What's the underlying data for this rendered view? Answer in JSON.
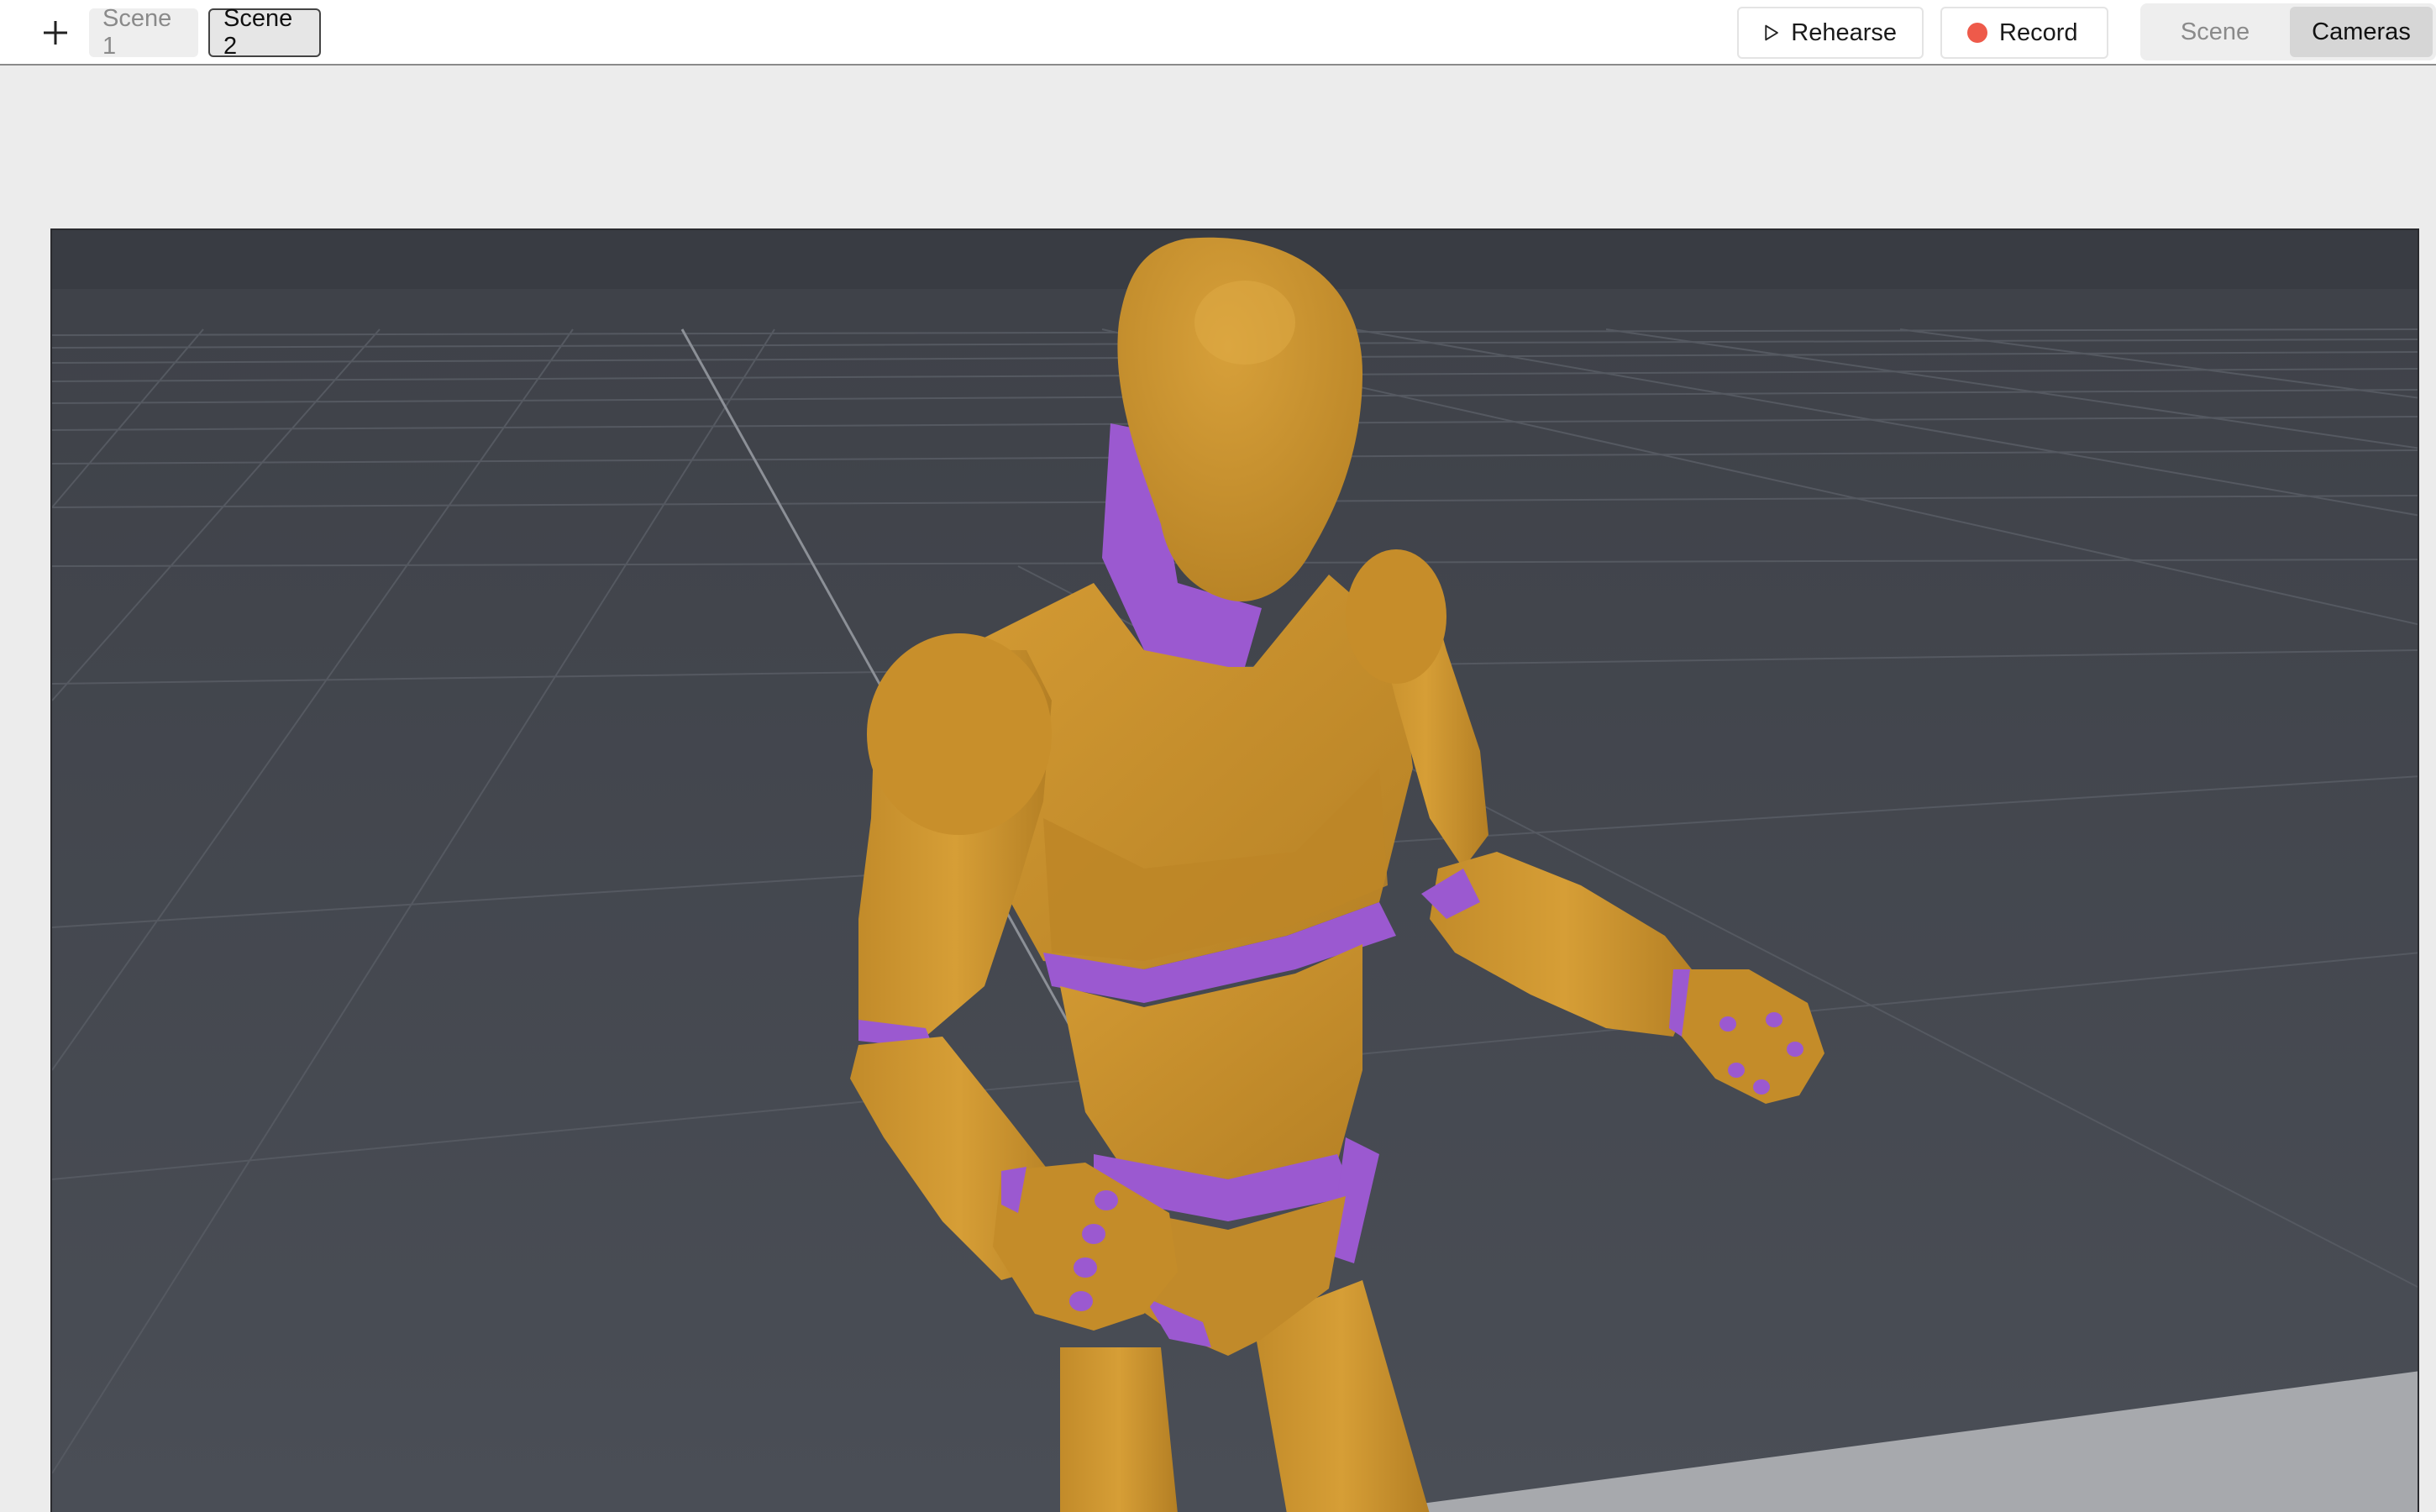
{
  "toolbar": {
    "add_icon": "plus-icon",
    "scenes": [
      {
        "label": "Scene 1",
        "active": false
      },
      {
        "label": "Scene 2",
        "active": true
      }
    ],
    "rehearse": {
      "label": "Rehearse",
      "icon": "play-icon"
    },
    "record": {
      "label": "Record",
      "icon": "record-dot-icon",
      "color": "#ee5a4a"
    },
    "view_toggle": [
      {
        "label": "Scene",
        "active": false
      },
      {
        "label": "Cameras",
        "active": true
      }
    ]
  },
  "viewport": {
    "content": "3d-mannequin-figure",
    "colors": {
      "background": "#454951",
      "sky": "#393c43",
      "figure_body": "#c8902c",
      "figure_joints": "#9b59d0",
      "floor_plane": "#a7a9ad"
    }
  }
}
